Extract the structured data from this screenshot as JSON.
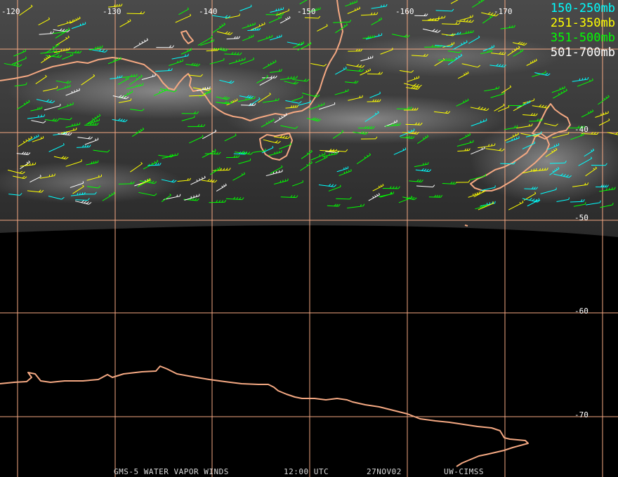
{
  "legend": [
    {
      "label": "150-250mb",
      "color": "#00ffff"
    },
    {
      "label": "251-350mb",
      "color": "#ffff00"
    },
    {
      "label": "351-500mb",
      "color": "#00ff00"
    },
    {
      "label": "501-700mb",
      "color": "#ffffff"
    }
  ],
  "longitude_labels": [
    "-120",
    "-130",
    "-140",
    "-150",
    "-160",
    "-170"
  ],
  "latitude_labels": [
    "-40",
    "-50",
    "-60",
    "-70"
  ],
  "footer": {
    "product": "GMS-5 WATER VAPOR WINDS",
    "time": "12:00 UTC",
    "date": "27NOV02",
    "source": "UW-CIMSS"
  },
  "colors": {
    "grid": "#f4a882",
    "coastline": "#f4a882",
    "background": "#000000"
  }
}
